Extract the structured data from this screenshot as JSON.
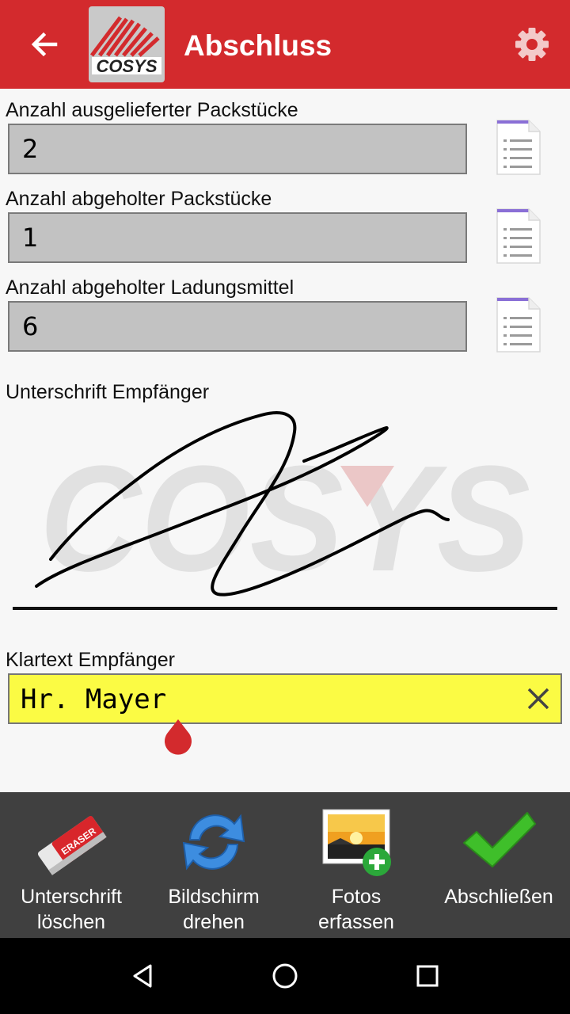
{
  "app_bar": {
    "title": "Abschluss",
    "back_icon": "arrow-left-icon",
    "settings_icon": "gear-icon",
    "logo_text": "COSYS",
    "color": "#d32a2d"
  },
  "fields": [
    {
      "label": "Anzahl ausgelieferter Packstücke",
      "value": "2"
    },
    {
      "label": "Anzahl abgeholter Packstücke",
      "value": "1"
    },
    {
      "label": "Anzahl abgeholter Ladungsmittel",
      "value": "6"
    }
  ],
  "signature": {
    "label": "Unterschrift Empfänger",
    "watermark_text": "COSYS"
  },
  "klartext": {
    "label": "Klartext Empfänger",
    "value": "Hr. Mayer",
    "background": "#fbfb44"
  },
  "toolbar": {
    "items": [
      {
        "line1": "Unterschrift",
        "line2": "löschen",
        "icon": "eraser-icon"
      },
      {
        "line1": "Bildschirm",
        "line2": "drehen",
        "icon": "rotate-icon"
      },
      {
        "line1": "Fotos",
        "line2": "erfassen",
        "icon": "add-photo-icon"
      },
      {
        "line1": "Abschließen",
        "line2": "",
        "icon": "checkmark-icon"
      }
    ]
  },
  "navbar": {
    "back_icon": "nav-back-icon",
    "home_icon": "nav-home-icon",
    "recents_icon": "nav-recents-icon"
  }
}
